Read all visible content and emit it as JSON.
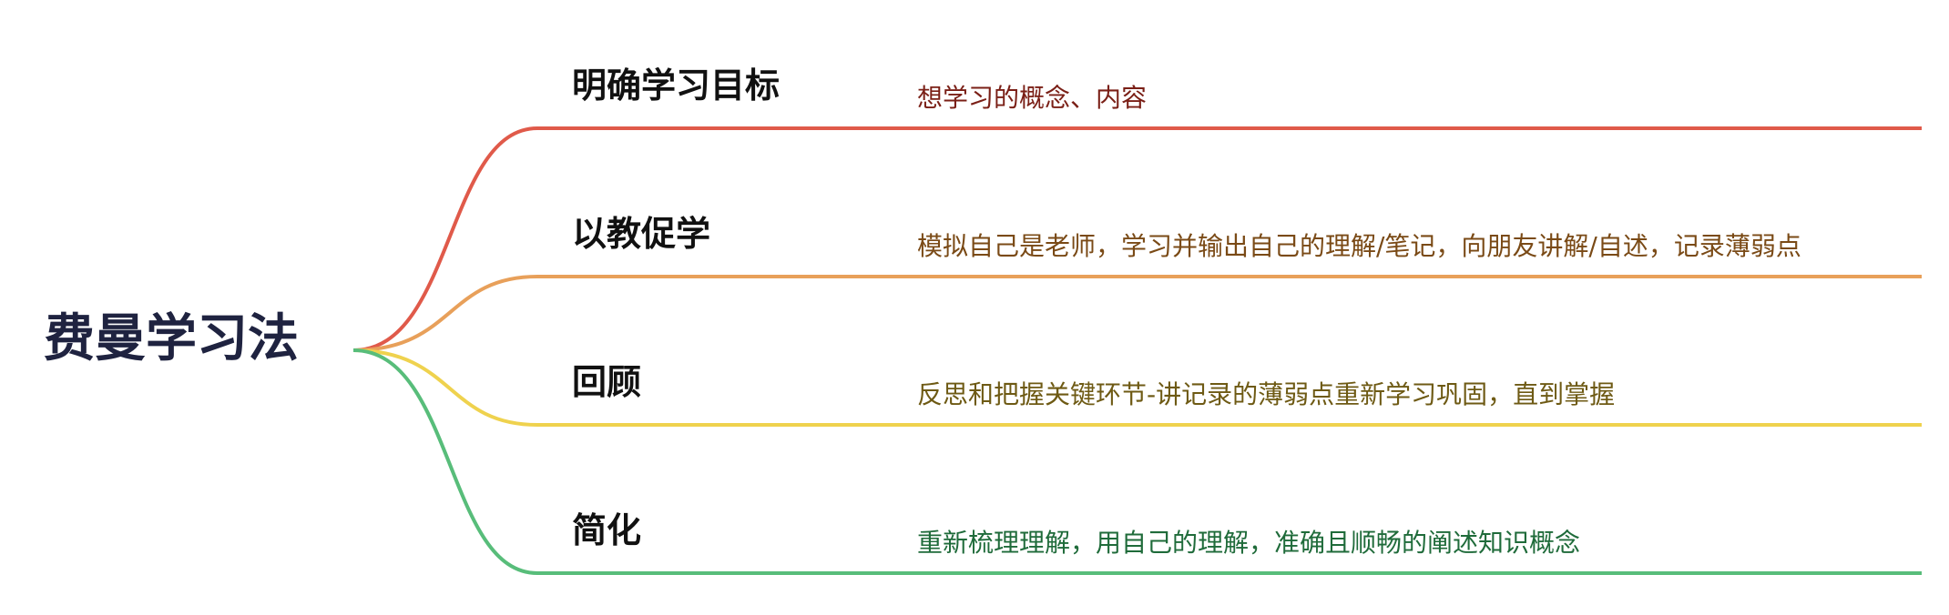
{
  "root": {
    "label": "费曼学习法",
    "color": "#1f2340"
  },
  "branches": [
    {
      "label": "明确学习目标",
      "detail": "想学习的概念、内容",
      "line_color": "#e05a4a",
      "text_color": "#7a1f16"
    },
    {
      "label": "以教促学",
      "detail": "模拟自己是老师，学习并输出自己的理解/笔记，向朋友讲解/自述，记录薄弱点",
      "line_color": "#e8a05a",
      "text_color": "#7a4a16"
    },
    {
      "label": "回顾",
      "detail": "反思和把握关键环节-讲记录的薄弱点重新学习巩固，直到掌握",
      "line_color": "#efd24e",
      "text_color": "#6e5a14"
    },
    {
      "label": "简化",
      "detail": "重新梳理理解，用自己的理解，准确且顺畅的阐述知识概念",
      "line_color": "#58bd7a",
      "text_color": "#1f6b3a"
    }
  ]
}
